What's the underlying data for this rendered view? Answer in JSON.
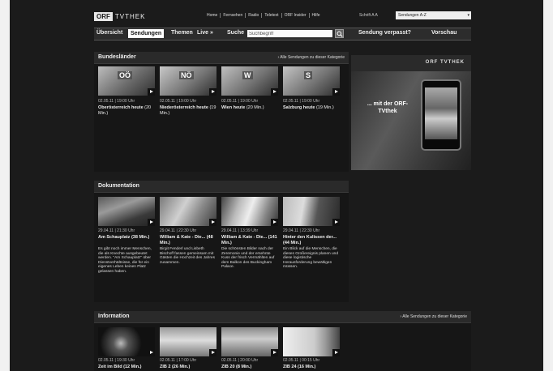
{
  "logo": {
    "orf": "ORF",
    "tvthek": "TVTHEK"
  },
  "top_links": [
    "Home",
    "Fernsehen",
    "Radio",
    "Teletext",
    "ORF Insider",
    "Hilfe"
  ],
  "schrift_label": "Schrift",
  "schrift_sizes": "A A",
  "sendungen_select": "Sendungen A-Z",
  "nav": {
    "uebersicht": "Übersicht",
    "sendungen": "Sendungen",
    "themen": "Themen",
    "live": "Live »",
    "suche": "Suche",
    "search_value": "Suchbegriff",
    "verpasst": "Sendung verpasst?",
    "vorschau": "Vorschau"
  },
  "bundeslaender": {
    "title": "Bundesländer",
    "link": "› Alle Sendungen zu dieser Kategorie",
    "items": [
      {
        "badge": "OÖ",
        "date": "02.05.11 | 19:00 Uhr",
        "title": "Oberösterreich heute",
        "duration": "(20 Min.)"
      },
      {
        "badge": "NÖ",
        "date": "02.05.11 | 19:00 Uhr",
        "title": "Niederösterreich heute",
        "duration": "(19 Min.)"
      },
      {
        "badge": "W",
        "date": "02.05.11 | 19:00 Uhr",
        "title": "Wien heute",
        "duration": "(20 Min.)"
      },
      {
        "badge": "S",
        "date": "02.05.11 | 19:00 Uhr",
        "title": "Salzburg heute",
        "duration": "(19 Min.)"
      }
    ]
  },
  "ad": {
    "logo": "ORF TVTHEK",
    "text": "... mit der ORF-TVthek"
  },
  "dokumentation": {
    "title": "Dokumentation",
    "items": [
      {
        "date": "29.04.11 | 21:30 Uhr",
        "title": "Am Schauplatz",
        "duration": "(38 Min.)",
        "desc": "Es gibt noch immer Menschen, die als Knechte ausgebeutet werden. \"Am Schauplatz\" über Dienstverhältnisse, die für ein eigenes Leben keinen Platz gelassen haben."
      },
      {
        "date": "29.04.11 | 22:30 Uhr",
        "title": "William & Kate - Die...",
        "duration": "(48 Min.)",
        "desc": "Birgit Fenderl und Lisbeth Bischoff fassen gemeinsam mit Gästen die Hochzeit des Jahres zusammen."
      },
      {
        "date": "29.04.11 | 13:39 Uhr",
        "title": "William & Kate - Die...",
        "duration": "(141 Min.)",
        "desc": "Die schönsten Bilder nach der Zeremonie und der ersehnte Kuss der frisch Vermählten auf dem Balkon des Buckingham Palace."
      },
      {
        "date": "29.04.11 | 22:30 Uhr",
        "title": "Hinter den Kulissen der...",
        "duration": "(44 Min.)",
        "desc": "Ein Blick auf die Menschen, die dieses Großereignis planen und diese logistische Herausforderung bewältigen müssen."
      }
    ]
  },
  "information": {
    "title": "Information",
    "link": "› Alle Sendungen zu dieser Kategorie",
    "items": [
      {
        "date": "02.05.11 | 19:30 Uhr",
        "title": "Zeit im Bild (12 Min.)"
      },
      {
        "date": "02.05.11 | 17:00 Uhr",
        "title": "ZIB 2 (26 Min.)"
      },
      {
        "date": "02.05.11 | 20:00 Uhr",
        "title": "ZIB 20 (8 Min.)"
      },
      {
        "date": "02.05.11 | 00:15 Uhr",
        "title": "ZIB 24 (16 Min.)"
      }
    ]
  }
}
